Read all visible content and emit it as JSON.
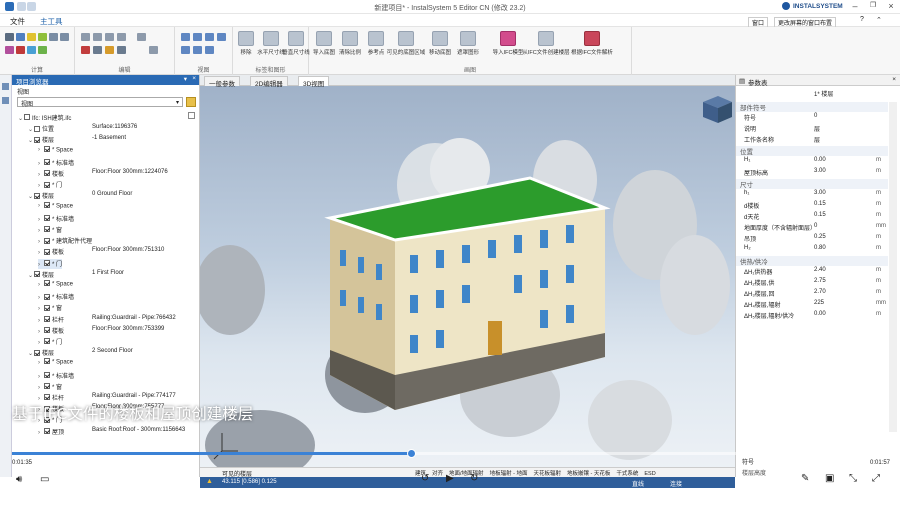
{
  "window": {
    "title": "新建项目* - InstalSystem 5 Editor CN (修改 23.2)",
    "brand": "INSTALSYSTEM"
  },
  "menu": {
    "items": [
      "文件",
      "主工具"
    ],
    "right_dropdown": "窗口",
    "right_layout": "更改屏幕的窗口布置"
  },
  "ribbon": {
    "groups": [
      "计算",
      "编辑",
      "视图",
      "标签和图形",
      "画图"
    ],
    "buttons": [
      "移除",
      "水平尺寸线",
      "垂直尺寸线",
      "导入底图",
      "清除比例",
      "参考点",
      "可见的底图区域",
      "移动底图",
      "遮罩图形",
      "导入IFC模型",
      "从IFC文件创建楼层",
      "根据IFC文件解析"
    ]
  },
  "left_panel": {
    "title": "项目浏览器",
    "filter_label": "视图",
    "dropdown_value": "视图",
    "tree": [
      {
        "level": 0,
        "label": "Ifc: ISH建筑.ifc",
        "value": "",
        "check": false
      },
      {
        "level": 1,
        "label": "位置",
        "value": "Surface:1196376",
        "check": false
      },
      {
        "level": 1,
        "label": "楼层",
        "value": "-1 Basement",
        "check": true
      },
      {
        "level": 2,
        "label": "* Space",
        "value": "",
        "check": true
      },
      {
        "level": 2,
        "label": "* 标准墙",
        "value": "",
        "check": true
      },
      {
        "level": 2,
        "label": "楼板",
        "value": "Floor:Floor 300mm:1224076",
        "check": true
      },
      {
        "level": 2,
        "label": "* 门",
        "value": "",
        "check": true
      },
      {
        "level": 1,
        "label": "楼层",
        "value": "0 Ground Floor",
        "check": true
      },
      {
        "level": 2,
        "label": "* Space",
        "value": "",
        "check": true
      },
      {
        "level": 2,
        "label": "* 标准墙",
        "value": "",
        "check": true
      },
      {
        "level": 2,
        "label": "* 窗",
        "value": "",
        "check": true
      },
      {
        "level": 2,
        "label": "* 建筑配件代理",
        "value": "",
        "check": true
      },
      {
        "level": 2,
        "label": "楼板",
        "value": "Floor:Floor 300mm:751310",
        "check": true
      },
      {
        "level": 2,
        "label": "* 门",
        "value": "",
        "check": true
      },
      {
        "level": 1,
        "label": "楼层",
        "value": "1 First Floor",
        "check": true
      },
      {
        "level": 2,
        "label": "* Space",
        "value": "",
        "check": true
      },
      {
        "level": 2,
        "label": "* 标准墙",
        "value": "",
        "check": true
      },
      {
        "level": 2,
        "label": "* 窗",
        "value": "",
        "check": true
      },
      {
        "level": 2,
        "label": "栏杆",
        "value": "Railing:Guardrail - Pipe:766432",
        "check": true
      },
      {
        "level": 2,
        "label": "楼板",
        "value": "Floor:Floor 300mm:753399",
        "check": true
      },
      {
        "level": 2,
        "label": "* 门",
        "value": "",
        "check": true
      },
      {
        "level": 1,
        "label": "楼层",
        "value": "2 Second Floor",
        "check": true
      },
      {
        "level": 2,
        "label": "* Space",
        "value": "",
        "check": true
      },
      {
        "level": 2,
        "label": "* 标准墙",
        "value": "",
        "check": true
      },
      {
        "level": 2,
        "label": "* 窗",
        "value": "",
        "check": true
      },
      {
        "level": 2,
        "label": "栏杆",
        "value": "Railing:Guardrail - Pipe:774177",
        "check": true
      },
      {
        "level": 2,
        "label": "楼板",
        "value": "Floor:Floor 300mm:755777",
        "check": true
      },
      {
        "level": 2,
        "label": "* 门",
        "value": "",
        "check": true
      },
      {
        "level": 2,
        "label": "屋顶",
        "value": "Basic Roof:Roof - 300mm:1156643",
        "check": true
      }
    ]
  },
  "tabs": [
    "一般参数",
    "2D编辑器",
    "3D视图"
  ],
  "right_panel": {
    "title": "参数表",
    "header_value": "1* 楼层",
    "sections": [
      {
        "name": "部件符号",
        "rows": [
          {
            "k": "符号",
            "v": "0",
            "u": ""
          },
          {
            "k": "说明",
            "v": "层",
            "u": ""
          },
          {
            "k": "工作条名称",
            "v": "层",
            "u": ""
          }
        ]
      },
      {
        "name": "位置",
        "rows": [
          {
            "k": "H₁",
            "v": "0.00",
            "u": "m"
          },
          {
            "k": "屋顶标高",
            "v": "3.00",
            "u": "m"
          }
        ]
      },
      {
        "name": "尺寸",
        "rows": [
          {
            "k": "h₁",
            "v": "3.00",
            "u": "m"
          },
          {
            "k": "d楼板",
            "v": "0.15",
            "u": "m"
          },
          {
            "k": "d天花",
            "v": "0.15",
            "u": "m"
          },
          {
            "k": "地面厚度（不含辐射面层）",
            "v": "0",
            "u": "mm"
          },
          {
            "k": "吊顶",
            "v": "0.25",
            "u": "m"
          },
          {
            "k": "H₂",
            "v": "0.80",
            "u": "m"
          }
        ]
      },
      {
        "name": "供热/供冷",
        "rows": [
          {
            "k": "ΔH₁供热器",
            "v": "2.40",
            "u": "m"
          },
          {
            "k": "ΔH₂楼层,供",
            "v": "2.75",
            "u": "m"
          },
          {
            "k": "ΔH₃楼层,回",
            "v": "2.70",
            "u": "m"
          },
          {
            "k": "ΔH₄楼层,辐射",
            "v": "225",
            "u": "mm"
          },
          {
            "k": "ΔH₅楼层,辐射/供冷",
            "v": "0.00",
            "u": "m"
          }
        ]
      }
    ],
    "footer_label": "符号",
    "footer_label2": "楼层高度"
  },
  "statusbar": {
    "coords": "43.115  [0.586]  0.125",
    "right_items": [
      "直线",
      "连接"
    ],
    "left_label": "可见的楼层",
    "bottom_tabs": [
      "建筑",
      "对齐",
      "地面/地面辐射",
      "地板辐射 - 地面",
      "天花板辐射",
      "地板嵌镶 - 天花板",
      "干式系统",
      "ESD"
    ]
  },
  "video": {
    "caption": "基于IFC文件的楼板和屋顶创建楼层",
    "time_current": "0:01:35",
    "time_total": "0:01:57",
    "progress": 0.455
  }
}
